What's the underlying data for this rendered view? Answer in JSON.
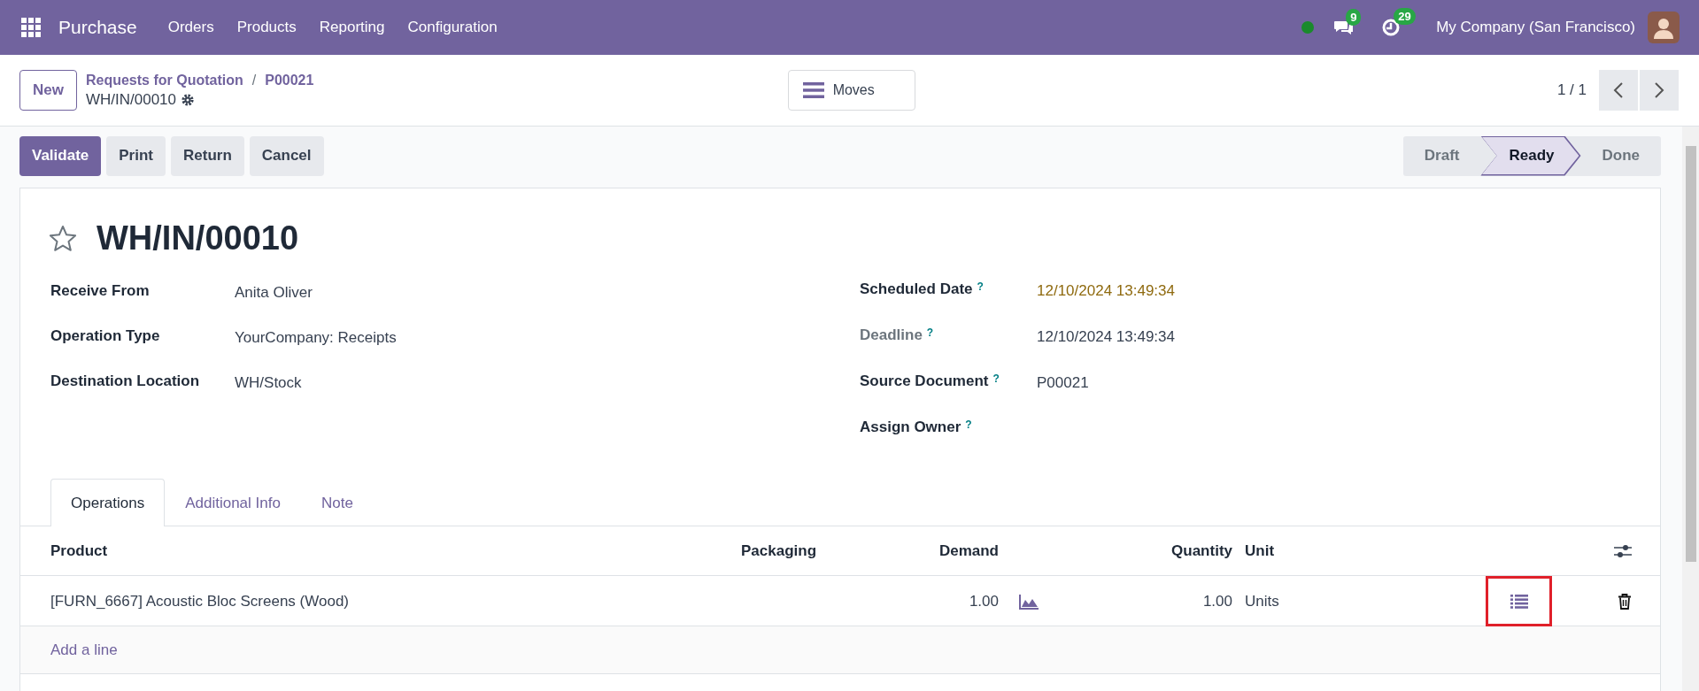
{
  "navbar": {
    "app_name": "Purchase",
    "menu": [
      "Orders",
      "Products",
      "Reporting",
      "Configuration"
    ],
    "online": true,
    "messages_count": "9",
    "activities_count": "29",
    "company": "My Company (San Francisco)"
  },
  "control_panel": {
    "new_button": "New",
    "breadcrumbs": [
      "Requests for Quotation",
      "P00021"
    ],
    "breadcrumb_separator": "/",
    "record_name": "WH/IN/00010",
    "view_button": "Moves",
    "pager": "1 / 1"
  },
  "action_buttons": [
    {
      "label": "Validate",
      "primary": true
    },
    {
      "label": "Print",
      "primary": false
    },
    {
      "label": "Return",
      "primary": false
    },
    {
      "label": "Cancel",
      "primary": false
    }
  ],
  "stages": [
    {
      "label": "Draft",
      "selected": false
    },
    {
      "label": "Ready",
      "selected": true
    },
    {
      "label": "Done",
      "selected": false
    }
  ],
  "form": {
    "starred": false,
    "title": "WH/IN/00010",
    "left_fields": [
      {
        "label": "Receive From",
        "value": "Anita Oliver"
      },
      {
        "label": "Operation Type",
        "value": "YourCompany: Receipts"
      },
      {
        "label": "Destination Location",
        "value": "WH/Stock"
      }
    ],
    "right_fields": [
      {
        "label": "Scheduled Date",
        "help": "?",
        "value": "12/10/2024 13:49:34",
        "warning": true,
        "muted": false
      },
      {
        "label": "Deadline",
        "help": "?",
        "value": "12/10/2024 13:49:34",
        "muted": true
      },
      {
        "label": "Source Document",
        "help": "?",
        "value": "P00021",
        "muted": false
      },
      {
        "label": "Assign Owner",
        "help": "?",
        "muted": false
      }
    ]
  },
  "tabs": [
    {
      "label": "Operations",
      "selected": true
    },
    {
      "label": "Additional Info",
      "selected": false
    },
    {
      "label": "Note",
      "selected": false
    }
  ],
  "table": {
    "columns": [
      "Product",
      "Packaging",
      "Demand",
      "Quantity",
      "Unit"
    ],
    "rows": [
      {
        "product": "[FURN_6667] Acoustic Bloc Screens (Wood)",
        "demand": "1.00",
        "quantity": "1.00",
        "unit": "Units",
        "highlighted": true
      }
    ],
    "add_line": "Add a line"
  }
}
